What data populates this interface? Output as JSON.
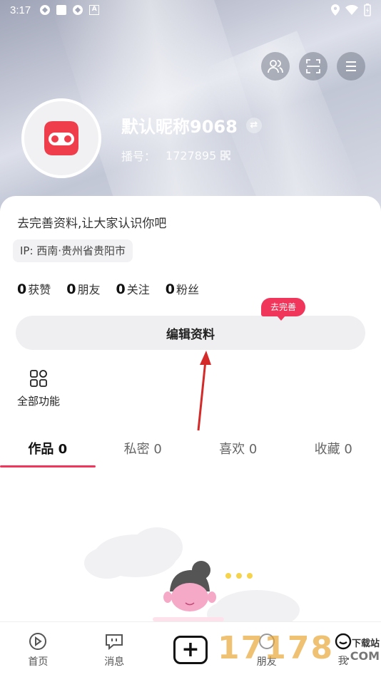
{
  "status_bar": {
    "time": "3:17"
  },
  "profile": {
    "nickname": "默认昵称9068",
    "id_label": "播号：",
    "id_value": "1727895",
    "bio": "去完善资料,让大家认识你吧",
    "ip_location": "IP: 西南·贵州省贵阳市"
  },
  "stats": [
    {
      "value": "0",
      "label": "获赞"
    },
    {
      "value": "0",
      "label": "朋友"
    },
    {
      "value": "0",
      "label": "关注"
    },
    {
      "value": "0",
      "label": "粉丝"
    }
  ],
  "edit_button": {
    "label": "编辑资料",
    "badge": "去完善"
  },
  "all_functions": {
    "label": "全部功能"
  },
  "tabs": [
    {
      "label": "作品 0",
      "active": true
    },
    {
      "label": "私密 0",
      "active": false
    },
    {
      "label": "喜欢 0",
      "active": false
    },
    {
      "label": "收藏 0",
      "active": false
    }
  ],
  "bottom_nav": {
    "home": "首页",
    "messages": "消息",
    "friends": "朋友",
    "me": "我"
  },
  "watermark": {
    "digits": "17178",
    "site": "下载站",
    "domain": ".COM"
  },
  "colors": {
    "accent": "#f0365a",
    "avatar_red": "#ef3d4b"
  }
}
